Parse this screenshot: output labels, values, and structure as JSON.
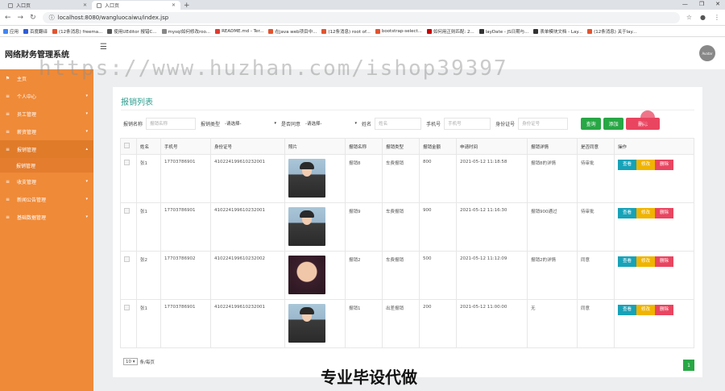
{
  "browser": {
    "tabs": [
      {
        "title": "入口页"
      },
      {
        "title": "入口页"
      }
    ],
    "url": "localhost:8080/wangluocaiwu/index.jsp",
    "bookmarks": [
      {
        "label": "应用",
        "color": "#4285f4"
      },
      {
        "label": "百度翻译",
        "color": "#2f5cd7"
      },
      {
        "label": "(12条消息) freema...",
        "color": "#e2542f"
      },
      {
        "label": "使用UEditor 报错C...",
        "color": "#555"
      },
      {
        "label": "mysql如何修改roo...",
        "color": "#888"
      },
      {
        "label": "README.md - Ter...",
        "color": "#e03c31"
      },
      {
        "label": "在java web项目中...",
        "color": "#e2542f"
      },
      {
        "label": "(12条消息) root of...",
        "color": "#e2542f"
      },
      {
        "label": "bootstrap-select...",
        "color": "#e2542f"
      },
      {
        "label": "如何用正则匹配: 2...",
        "color": "#c00"
      },
      {
        "label": "layDate - JS日期与...",
        "color": "#333"
      },
      {
        "label": "表单模块文档 - Lay...",
        "color": "#333"
      },
      {
        "label": "(12条消息) 关于lay...",
        "color": "#e2542f"
      }
    ]
  },
  "app": {
    "title": "网络财务管理系统",
    "avatar_text": "Avatar"
  },
  "sidebar": {
    "items": [
      {
        "label": "主页",
        "icon": "flag-icon",
        "chevron": ""
      },
      {
        "label": "个人中心",
        "icon": "menu-icon",
        "chevron": "▾"
      },
      {
        "label": "员工管理",
        "icon": "menu-icon",
        "chevron": "▾"
      },
      {
        "label": "薪资管理",
        "icon": "menu-icon",
        "chevron": "▾"
      },
      {
        "label": "报销管理",
        "icon": "menu-icon",
        "chevron": "▴"
      },
      {
        "label": "收支管理",
        "icon": "menu-icon",
        "chevron": "▾"
      },
      {
        "label": "新闻公告管理",
        "icon": "menu-icon",
        "chevron": "▾"
      },
      {
        "label": "基础数据管理",
        "icon": "menu-icon",
        "chevron": "▾"
      }
    ],
    "active_sub": "报销管理"
  },
  "main": {
    "card_title": "报销列表",
    "filters": {
      "name_label": "报销名称",
      "name_placeholder": "报销名称",
      "type_label": "报销类型",
      "type_value": "-请选择-",
      "agree_label": "是否同意",
      "agree_value": "-请选择-",
      "person_label": "姓名",
      "person_placeholder": "姓名",
      "phone_label": "手机号",
      "phone_placeholder": "手机号",
      "id_label": "身份证号",
      "id_placeholder": "身份证号",
      "query": "查询",
      "add": "添加",
      "delete": "删除"
    },
    "columns": [
      "姓名",
      "手机号",
      "身份证号",
      "照片",
      "报销名称",
      "报销类型",
      "报销金额",
      "申请时间",
      "报销详情",
      "是否同意",
      "操作"
    ],
    "rows": [
      {
        "name": "张1",
        "phone": "17703786901",
        "idcard": "410224199610232001",
        "photo": "a",
        "title": "报销8",
        "type": "车费报销",
        "amount": "800",
        "time": "2021-05-12 11:18:58",
        "detail": "报销8的详情",
        "agree": "待审批"
      },
      {
        "name": "张1",
        "phone": "17703786901",
        "idcard": "410224199610232001",
        "photo": "a",
        "title": "报销9",
        "type": "车费报销",
        "amount": "900",
        "time": "2021-05-12 11:16:30",
        "detail": "报销900通过",
        "agree": "待审批"
      },
      {
        "name": "张2",
        "phone": "17703786902",
        "idcard": "410224199610232002",
        "photo": "b",
        "title": "报销2",
        "type": "车费报销",
        "amount": "500",
        "time": "2021-05-12 11:12:09",
        "detail": "报销2的详情",
        "agree": "同意"
      },
      {
        "name": "张1",
        "phone": "17703786901",
        "idcard": "410224199610232001",
        "photo": "a",
        "title": "报销1",
        "type": "出差报销",
        "amount": "200",
        "time": "2021-05-12 11:00:00",
        "detail": "无",
        "agree": "同意"
      }
    ],
    "ops": {
      "view": "查看",
      "edit": "修改",
      "del": "删除"
    },
    "pager": {
      "page_size": "10",
      "per_page_text": "条/每页",
      "current_page": "1"
    }
  },
  "watermark": "https://www.huzhan.com/ishop39397",
  "caption": "专业毕设代做",
  "colors": {
    "sidebar": "#ef8a38",
    "accent": "#2e9e8f",
    "green": "#28a745",
    "red": "#e94560",
    "cyan": "#17a2b8",
    "yellow": "#f0b400"
  }
}
